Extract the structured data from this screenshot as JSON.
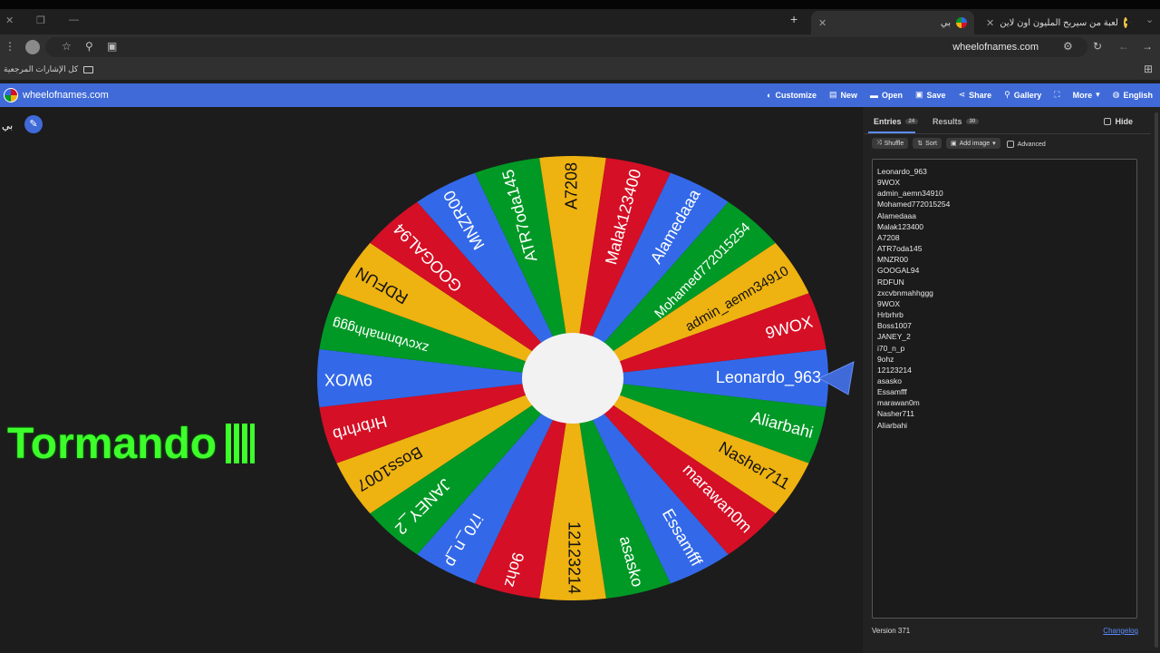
{
  "browser": {
    "tabs": [
      {
        "title": "لعبة من سيربح المليون اون لاين",
        "active": false
      },
      {
        "title": "بي",
        "active": true
      }
    ],
    "url": "wheelofnames.com",
    "bookmarks_label": "كل الإشارات المرجعية"
  },
  "site": {
    "brand": "wheelofnames.com",
    "nav": [
      "Customize",
      "New",
      "Open",
      "Save",
      "Share",
      "Gallery",
      "More",
      "English"
    ]
  },
  "wheel": {
    "title": "بي",
    "colors": [
      "#3369e8",
      "#009925",
      "#eeb211",
      "#d50f25"
    ],
    "segments": [
      "Leonardo_963",
      "Aliarbahi",
      "Nasher711",
      "marawan0m",
      "Essamfff",
      "asasko",
      "12123214",
      "9ohz",
      "i70_n_p",
      "JANEY_2",
      "Boss1007",
      "Hrbrhrb",
      "9WOX",
      "zxcvbnmahhggg",
      "RDFUN",
      "GOOGAL94",
      "MNZR00",
      "ATR7oda145",
      "A7208",
      "Malak123400",
      "Alamedaaa",
      "Mohamed772015254",
      "admin_aemn34910",
      "9WOX"
    ]
  },
  "overlay_text": "Tormando",
  "panel": {
    "tabs": [
      {
        "label": "Entries",
        "count": "24"
      },
      {
        "label": "Results",
        "count": "30"
      }
    ],
    "hide_label": "Hide",
    "tools": [
      "Shuffle",
      "Sort",
      "Add image"
    ],
    "advanced_label": "Advanced",
    "entries": [
      "Leonardo_963",
      "9WOX",
      "admin_aemn34910",
      "Mohamed772015254",
      "Alamedaaa",
      "Malak123400",
      "A7208",
      "ATR7oda145",
      "MNZR00",
      "GOOGAL94",
      "RDFUN",
      "zxcvbnmahhggg",
      "9WOX",
      "Hrbrhrb",
      "Boss1007",
      "JANEY_2",
      "i70_n_p",
      "9ohz",
      "12123214",
      "asasko",
      "Essamfff",
      "marawan0m",
      "Nasher711",
      "Aliarbahi"
    ],
    "version": "Version 371",
    "changelog": "Changelog"
  }
}
